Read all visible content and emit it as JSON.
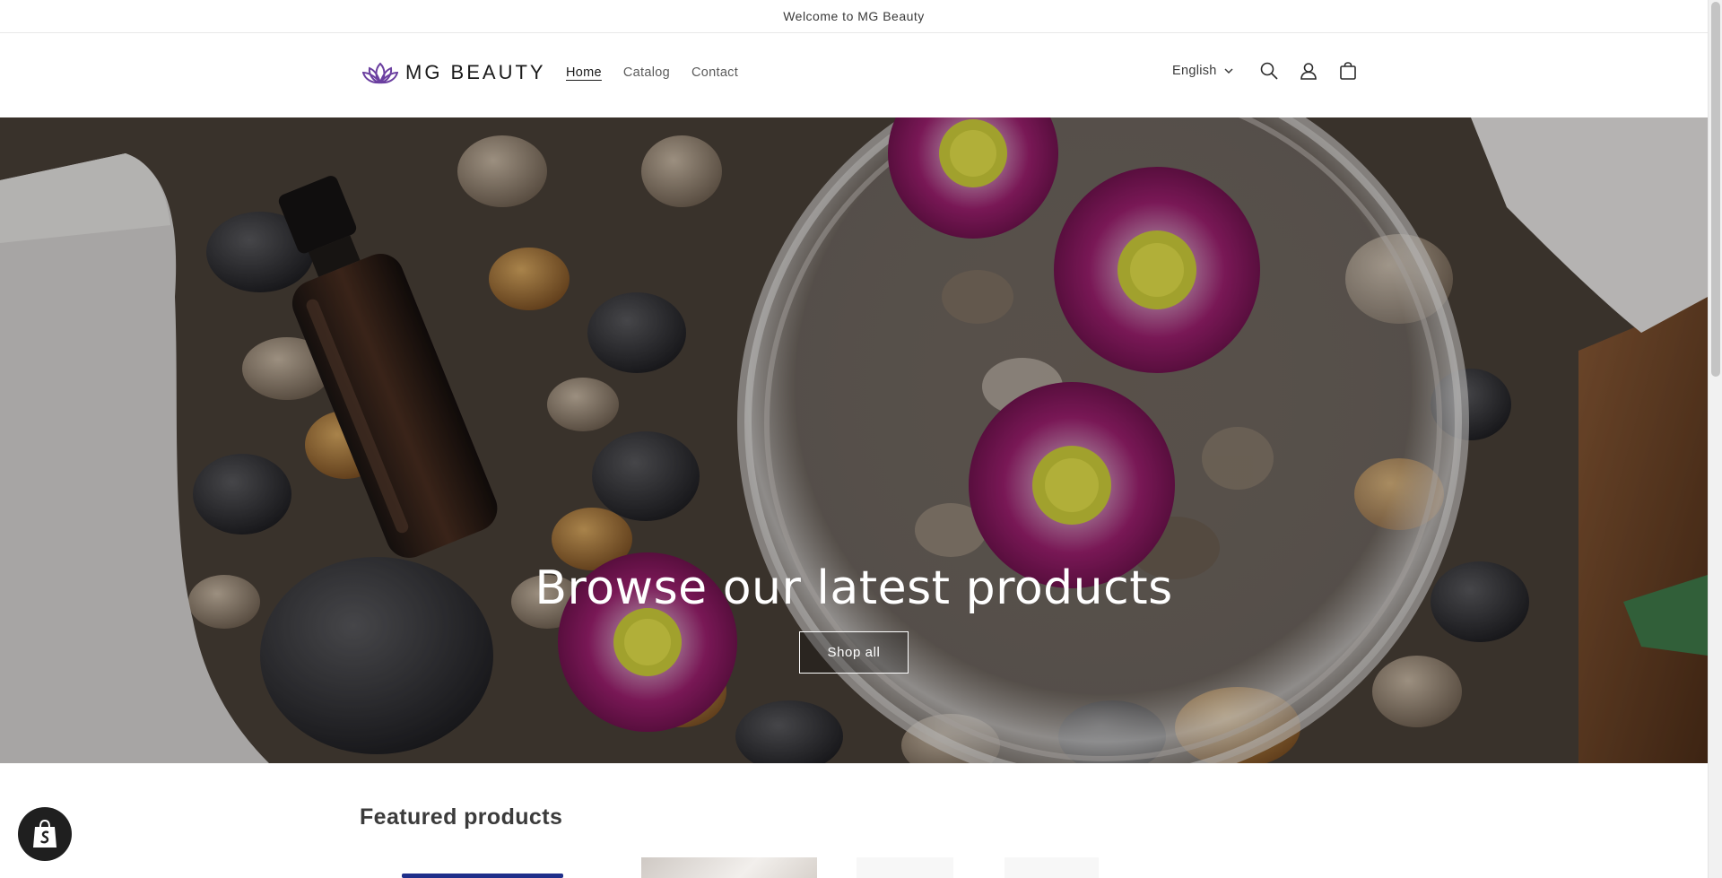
{
  "announcement": {
    "text": "Welcome to MG Beauty"
  },
  "header": {
    "logo_text": "MG BEAUTY",
    "nav": [
      {
        "label": "Home",
        "active": true
      },
      {
        "label": "Catalog",
        "active": false
      },
      {
        "label": "Contact",
        "active": false
      }
    ],
    "language": "English",
    "icons": [
      "search-icon",
      "account-icon",
      "cart-icon"
    ]
  },
  "hero": {
    "title": "Browse our latest products",
    "button_label": "Shop all"
  },
  "featured": {
    "title": "Featured products"
  },
  "colors": {
    "accent_purple": "#6b3fa0",
    "flower_magenta": "#9b1f6e",
    "text_dark": "#121212"
  }
}
